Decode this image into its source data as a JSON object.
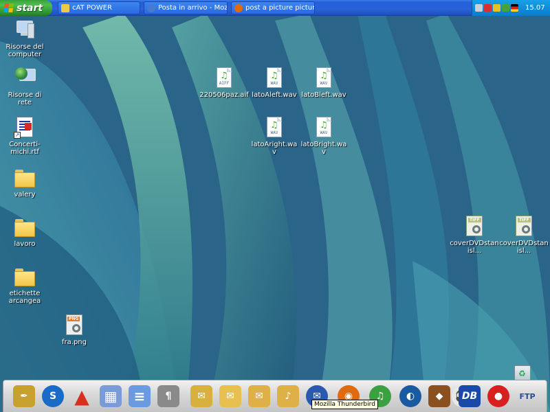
{
  "taskbar": {
    "start_label": "start",
    "tasks": [
      {
        "label": "cAT POWER",
        "icon": "folder-icon"
      },
      {
        "label": "Posta in arrivo - Mozill...",
        "icon": "thunderbird-icon"
      },
      {
        "label": "post a picture picture...",
        "icon": "firefox-icon"
      }
    ],
    "tray_icons": [
      "network-icon",
      "security-icon",
      "zonealarm-icon",
      "bluetooth-icon",
      "flag-icon"
    ],
    "clock": "15.07"
  },
  "desktop": {
    "icons": [
      {
        "label": "Risorse del computer",
        "icon": "my-computer-icon"
      },
      {
        "label": "Risorse di rete",
        "icon": "network-places-icon"
      },
      {
        "label": "Concerti-michi.rtf",
        "icon": "rtf-document-icon"
      },
      {
        "label": "valery",
        "icon": "folder-icon"
      },
      {
        "label": "lavoro",
        "icon": "folder-icon"
      },
      {
        "label": "etichette arcangea",
        "icon": "folder-icon"
      },
      {
        "label": "fra.png",
        "icon": "png-file-icon",
        "type": "PNG"
      },
      {
        "label": "220506paz.aif",
        "icon": "aiff-audio-icon",
        "type": "AIFF"
      },
      {
        "label": "latoAleft.wav",
        "icon": "wav-audio-icon",
        "type": "WAV"
      },
      {
        "label": "latoBleft.wav",
        "icon": "wav-audio-icon",
        "type": "WAV"
      },
      {
        "label": "latoAright.wav",
        "icon": "wav-audio-icon",
        "type": "WAV"
      },
      {
        "label": "latoBright.wav",
        "icon": "wav-audio-icon",
        "type": "WAV"
      },
      {
        "label": "coverDVDstanisl...",
        "icon": "tiff-file-icon",
        "type": "TIFF"
      },
      {
        "label": "coverDVDstanisl...",
        "icon": "tiff-file-icon",
        "type": "TIFF"
      }
    ],
    "recycle_bin_icon": "recycle-bin-icon"
  },
  "dock": {
    "items": [
      {
        "name": "quill-app-icon",
        "glyph": "✒",
        "color": "#c8a030"
      },
      {
        "name": "flashget-icon",
        "glyph": "S",
        "color": "#1a6ac8"
      },
      {
        "name": "pyramid-app-icon",
        "glyph": "▲",
        "color": "#d83020"
      },
      {
        "name": "calculator-icon",
        "glyph": "▦",
        "color": "#7a9ad8"
      },
      {
        "name": "notepad-icon",
        "glyph": "≡",
        "color": "#6a9ae0"
      },
      {
        "name": "text-editor-icon",
        "glyph": "¶",
        "color": "#8a8a8a"
      },
      {
        "name": "network-tool-icon",
        "glyph": "✉",
        "color": "#d8b040"
      },
      {
        "name": "folder-mail-icon",
        "glyph": "✉",
        "color": "#e8c050"
      },
      {
        "name": "folder-dock-icon",
        "glyph": "✉",
        "color": "#e0b048"
      },
      {
        "name": "folder-music-icon",
        "glyph": "♪",
        "color": "#e0b048"
      },
      {
        "name": "thunderbird-icon",
        "glyph": "✉",
        "color": "#2a5ab0"
      },
      {
        "name": "firefox-icon",
        "glyph": "◉",
        "color": "#e06a10"
      },
      {
        "name": "media-player-icon",
        "glyph": "♫",
        "color": "#3aa040"
      },
      {
        "name": "google-earth-icon",
        "glyph": "◐",
        "color": "#1a5aa0"
      },
      {
        "name": "emule-icon",
        "glyph": "◆",
        "color": "#8a5020"
      },
      {
        "name": "soccer-ball-icon",
        "glyph": "⚽",
        "color": "#6a6a6a"
      },
      {
        "name": "db-app-icon",
        "glyph": "DB",
        "color": "#1a4aa8"
      },
      {
        "name": "burning-app-icon",
        "glyph": "●",
        "color": "#d82020"
      },
      {
        "name": "ftp-app-icon",
        "glyph": "FTP",
        "color": "#2a4a9a"
      }
    ],
    "tooltip": "Mozilla Thunderbird"
  }
}
